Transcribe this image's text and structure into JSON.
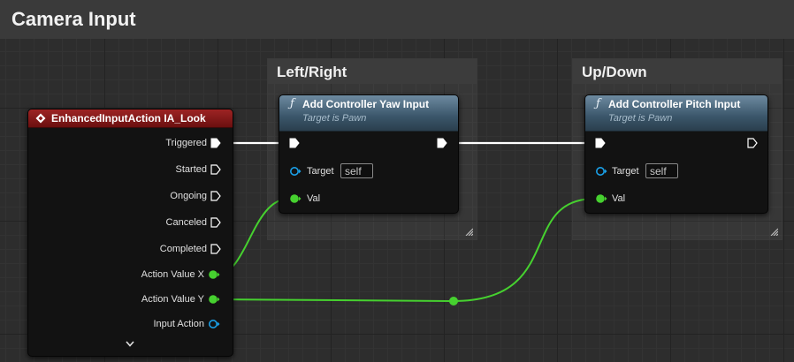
{
  "comment": {
    "title": "Camera Input"
  },
  "comment_left_right": {
    "title": "Left/Right"
  },
  "comment_up_down": {
    "title": "Up/Down"
  },
  "event_node": {
    "title": "EnhancedInputAction IA_Look",
    "header_color": "#8f1c1c",
    "icon": "diamond-icon",
    "pins": {
      "triggered": "Triggered",
      "started": "Started",
      "ongoing": "Ongoing",
      "canceled": "Canceled",
      "completed": "Completed",
      "action_value_x": "Action Value X",
      "action_value_y": "Action Value Y",
      "input_action": "Input Action"
    },
    "expand_icon": "chevron-down-icon"
  },
  "yaw_node": {
    "title": "Add Controller Yaw Input",
    "subtitle": "Target is Pawn",
    "icon_glyph": "ƒ",
    "target_label": "Target",
    "target_value": "self",
    "val_label": "Val"
  },
  "pitch_node": {
    "title": "Add Controller Pitch Input",
    "subtitle": "Target is Pawn",
    "icon_glyph": "ƒ",
    "target_label": "Target",
    "target_value": "self",
    "val_label": "Val"
  },
  "colors": {
    "exec_wire": "#ffffff",
    "float_wire": "#3fd12a",
    "object_pin": "#1aa0e8",
    "function_header": "#4a6a82"
  }
}
